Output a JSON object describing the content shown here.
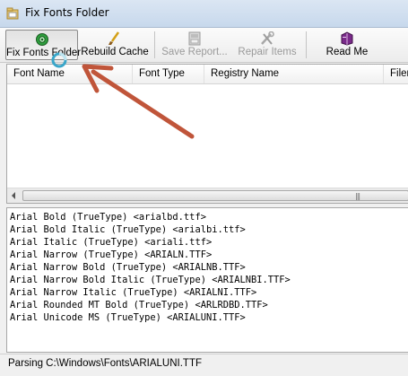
{
  "window": {
    "title": "Fix Fonts Folder"
  },
  "toolbar": {
    "buttons": [
      {
        "label": "Fix Fonts Folder",
        "icon": "fix-fonts-icon",
        "state": "pressed"
      },
      {
        "label": "Rebuild Cache",
        "icon": "brush-icon",
        "state": "enabled"
      },
      {
        "label": "Save Report...",
        "icon": "save-report-icon",
        "state": "disabled"
      },
      {
        "label": "Repair Items",
        "icon": "repair-icon",
        "state": "disabled"
      },
      {
        "label": "Read Me",
        "icon": "book-icon",
        "state": "enabled"
      }
    ]
  },
  "list": {
    "columns": [
      "Font Name",
      "Font Type",
      "Registry Name",
      "Filen"
    ]
  },
  "log": {
    "lines": [
      "Arial Bold (TrueType) <arialbd.ttf>",
      "Arial Bold Italic (TrueType) <arialbi.ttf>",
      "Arial Italic (TrueType) <ariali.ttf>",
      "Arial Narrow (TrueType) <ARIALN.TTF>",
      "Arial Narrow Bold (TrueType) <ARIALNB.TTF>",
      "Arial Narrow Bold Italic (TrueType) <ARIALNBI.TTF>",
      "Arial Narrow Italic (TrueType) <ARIALNI.TTF>",
      "Arial Rounded MT Bold (TrueType) <ARLRDBD.TTF>",
      "Arial Unicode MS (TrueType) <ARIALUNI.TTF>"
    ]
  },
  "status": {
    "text": "Parsing C:\\Windows\\Fonts\\ARIALUNI.TTF"
  },
  "colors": {
    "annotation_arrow": "#c0553a",
    "busy_cursor": "#3aa6c9"
  }
}
